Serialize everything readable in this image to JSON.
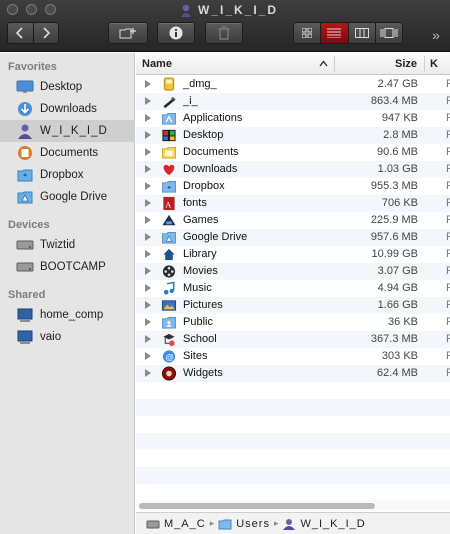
{
  "window": {
    "title": "W_I_K_I_D"
  },
  "toolbar": {
    "buttons": [
      "back-icon",
      "forward-icon",
      "new-folder-icon",
      "info-icon",
      "trash-icon"
    ],
    "view_modes": [
      "icon-view-icon",
      "list-view-icon",
      "column-view-icon",
      "coverflow-view-icon"
    ],
    "active_view": "list-view-icon",
    "overflow": "»"
  },
  "sidebar": {
    "favorites_header": "Favorites",
    "favorites": [
      {
        "label": "Desktop",
        "icon": "desktop-icon"
      },
      {
        "label": "Downloads",
        "icon": "downloads-icon"
      },
      {
        "label": "W_I_K_I_D",
        "icon": "user-home-icon",
        "selected": true
      },
      {
        "label": "Documents",
        "icon": "documents-icon"
      },
      {
        "label": "Dropbox",
        "icon": "dropbox-icon"
      },
      {
        "label": "Google Drive",
        "icon": "google-drive-icon"
      }
    ],
    "devices_header": "Devices",
    "devices": [
      {
        "label": "Twiztid",
        "icon": "hard-drive-icon"
      },
      {
        "label": "BOOTCAMP",
        "icon": "hard-drive-icon"
      }
    ],
    "shared_header": "Shared",
    "shared": [
      {
        "label": "home_comp",
        "icon": "network-computer-icon"
      },
      {
        "label": "vaio",
        "icon": "network-computer-icon"
      }
    ]
  },
  "columns": {
    "name": "Name",
    "size": "Size",
    "kind": "K"
  },
  "files": [
    {
      "name": "_dmg_",
      "size": "2.47 GB",
      "kind": "F",
      "icon": "dmg-folder-icon"
    },
    {
      "name": "_i_",
      "size": "863.4 MB",
      "kind": "F",
      "icon": "folder-i-icon"
    },
    {
      "name": "Applications",
      "size": "947 KB",
      "kind": "F",
      "icon": "applications-folder-icon"
    },
    {
      "name": "Desktop",
      "size": "2.8 MB",
      "kind": "F",
      "icon": "desktop-folder-icon"
    },
    {
      "name": "Documents",
      "size": "90.6 MB",
      "kind": "F",
      "icon": "documents-folder-icon"
    },
    {
      "name": "Downloads",
      "size": "1.03 GB",
      "kind": "F",
      "icon": "downloads-folder-icon"
    },
    {
      "name": "Dropbox",
      "size": "955.3 MB",
      "kind": "F",
      "icon": "dropbox-folder-icon"
    },
    {
      "name": "fonts",
      "size": "706 KB",
      "kind": "F",
      "icon": "fonts-folder-icon"
    },
    {
      "name": "Games",
      "size": "225.9 MB",
      "kind": "F",
      "icon": "games-folder-icon"
    },
    {
      "name": "Google Drive",
      "size": "957.6 MB",
      "kind": "F",
      "icon": "google-drive-folder-icon"
    },
    {
      "name": "Library",
      "size": "10.99 GB",
      "kind": "F",
      "icon": "library-folder-icon"
    },
    {
      "name": "Movies",
      "size": "3.07 GB",
      "kind": "F",
      "icon": "movies-folder-icon"
    },
    {
      "name": "Music",
      "size": "4.94 GB",
      "kind": "F",
      "icon": "music-folder-icon"
    },
    {
      "name": "Pictures",
      "size": "1.66 GB",
      "kind": "F",
      "icon": "pictures-folder-icon"
    },
    {
      "name": "Public",
      "size": "36 KB",
      "kind": "F",
      "icon": "public-folder-icon"
    },
    {
      "name": "School",
      "size": "367.3 MB",
      "kind": "F",
      "icon": "school-folder-icon"
    },
    {
      "name": "Sites",
      "size": "303 KB",
      "kind": "F",
      "icon": "sites-folder-icon"
    },
    {
      "name": "Widgets",
      "size": "62.4 MB",
      "kind": "F",
      "icon": "widgets-folder-icon"
    }
  ],
  "pathbar": [
    {
      "label": "M_A_C",
      "icon": "hard-drive-icon"
    },
    {
      "label": "Users",
      "icon": "users-folder-icon"
    },
    {
      "label": "W_I_K_I_D",
      "icon": "user-home-icon"
    }
  ],
  "colors": {
    "toolbar_dark": "#2e2e2e",
    "active_view": "#9a1212",
    "sidebar_bg": "#e5e5e5",
    "selected_sidebar": "#cfcfcf",
    "alt_row": "#f3f6fa"
  }
}
